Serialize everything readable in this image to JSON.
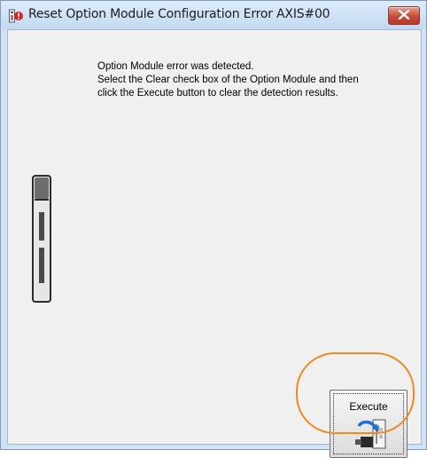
{
  "window": {
    "title": "Reset Option Module Configuration Error AXIS#00"
  },
  "message": {
    "lines": [
      "Option Module error was detected.",
      "Select the Clear check box of the Option Module and then",
      "click the Execute button to clear the detection results."
    ]
  },
  "module_icon": "servo-module-icon",
  "execute_button": {
    "label": "Execute",
    "icon": "execute-connector-icon"
  },
  "colors": {
    "highlight": "#f08a1d",
    "close_button": "#c74a36",
    "titlebar": "#cfe2f6"
  }
}
